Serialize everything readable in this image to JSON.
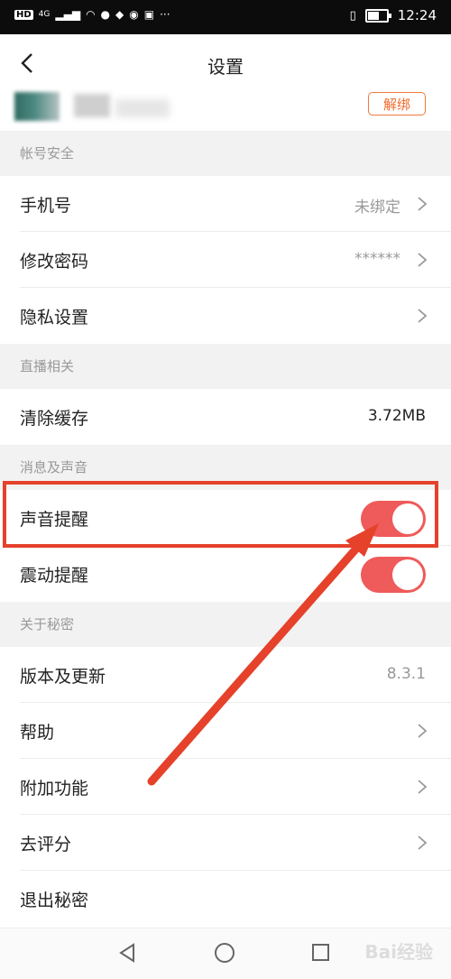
{
  "status_bar": {
    "left_badges": [
      "HD",
      "4G"
    ],
    "time": "12:24"
  },
  "header": {
    "title": "设置"
  },
  "account": {
    "unbind_label": "解绑"
  },
  "sections": {
    "account_security": "帐号安全",
    "live": "直播相关",
    "messages": "消息及声音",
    "about": "关于秘密"
  },
  "rows": {
    "phone": {
      "label": "手机号",
      "value": "未绑定"
    },
    "password": {
      "label": "修改密码",
      "value": "******"
    },
    "privacy": {
      "label": "隐私设置"
    },
    "cache": {
      "label": "清除缓存",
      "value": "3.72MB"
    },
    "sound": {
      "label": "声音提醒",
      "on": true
    },
    "vibrate": {
      "label": "震动提醒",
      "on": true
    },
    "version": {
      "label": "版本及更新",
      "value": "8.3.1"
    },
    "help": {
      "label": "帮助"
    },
    "extras": {
      "label": "附加功能"
    },
    "rate": {
      "label": "去评分"
    },
    "logout": {
      "label": "退出秘密"
    }
  },
  "watermark": "Bai经验",
  "colors": {
    "accent_orange": "#f06a2c",
    "toggle_on": "#ef5a5a",
    "annotation_red": "#e5412b"
  }
}
